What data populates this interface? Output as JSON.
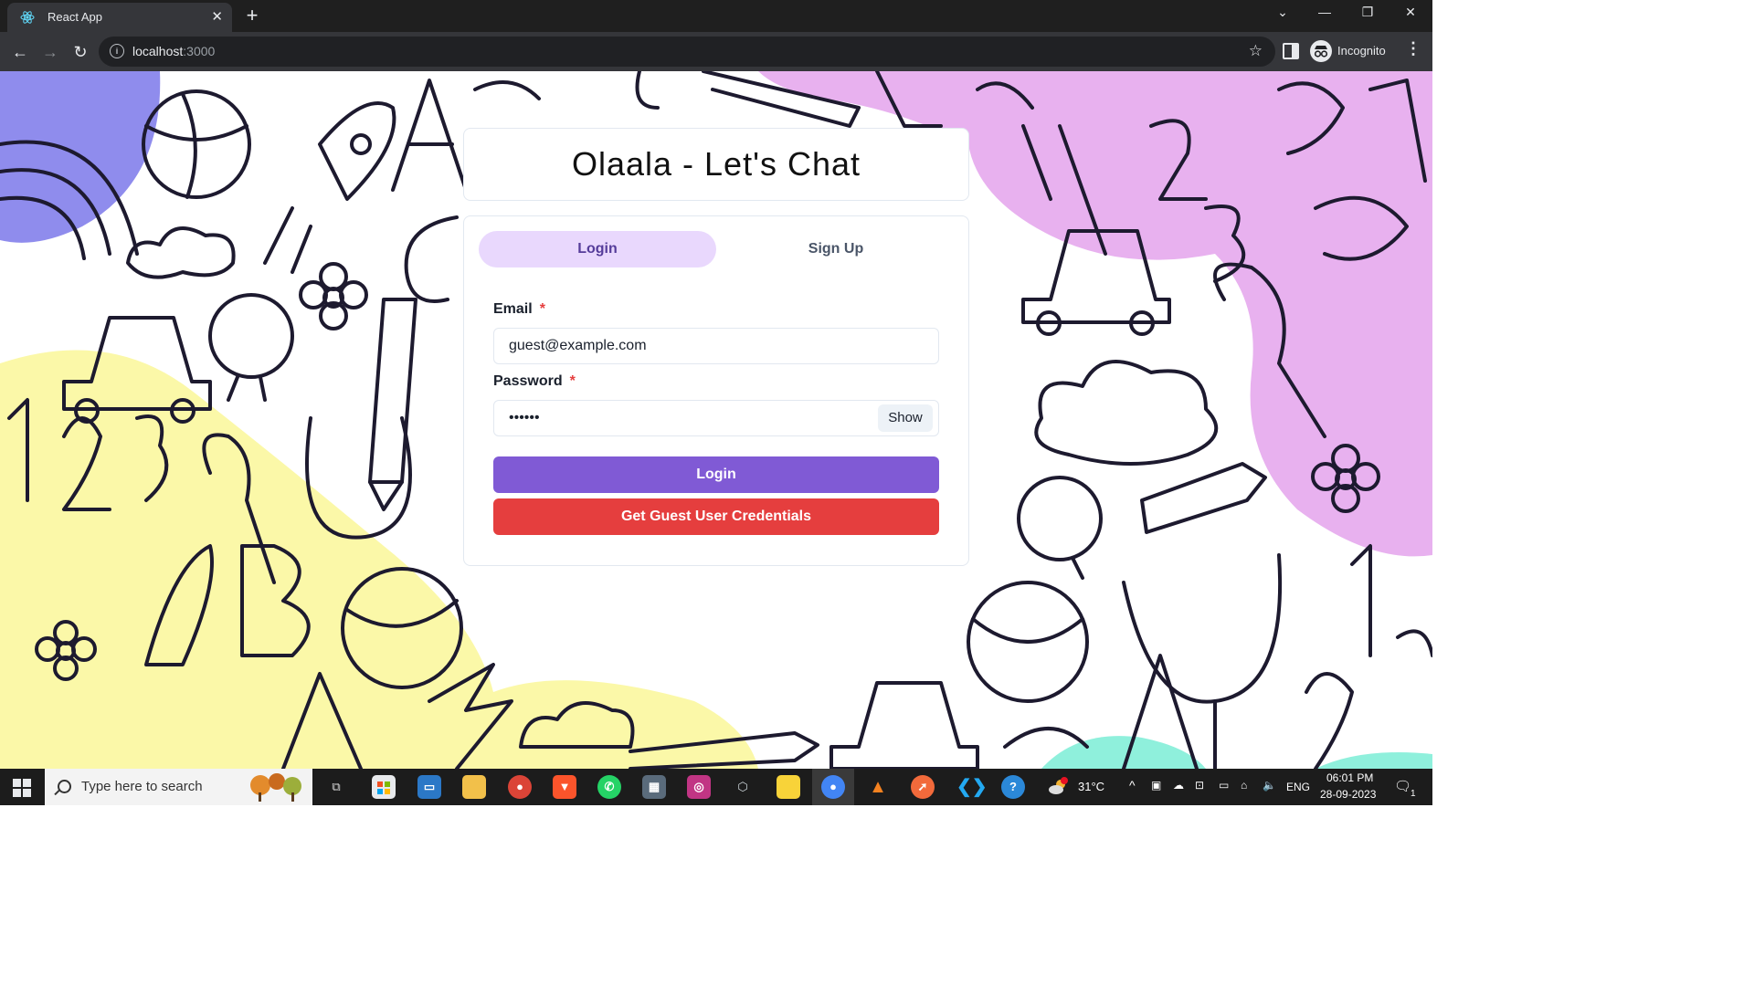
{
  "browser": {
    "tab_title": "React App",
    "url_host": "localhost",
    "url_port": ":3000",
    "profile_label": "Incognito"
  },
  "app": {
    "title": "Olaala - Let's Chat",
    "tabs": [
      {
        "label": "Login",
        "active": true
      },
      {
        "label": "Sign Up",
        "active": false
      }
    ],
    "email": {
      "label": "Email",
      "required_mark": "*",
      "value": "guest@example.com"
    },
    "password": {
      "label": "Password",
      "required_mark": "*",
      "value": "••••••",
      "toggle_label": "Show"
    },
    "login_button": "Login",
    "guest_button": "Get Guest User Credentials"
  },
  "taskbar": {
    "search_placeholder": "Type here to search",
    "temperature": "31°C",
    "language": "ENG",
    "time": "06:01 PM",
    "date": "28-09-2023",
    "notification_count": "1"
  },
  "colors": {
    "accent_purple": "#805ad5",
    "tab_active_bg": "#e9d8fd",
    "danger_red": "#e53e3e",
    "blob_yellow": "#fbf8a8",
    "blob_pink": "#e8b1ef",
    "blob_blue": "#8f8ced",
    "blob_teal": "#8ff0dc"
  }
}
